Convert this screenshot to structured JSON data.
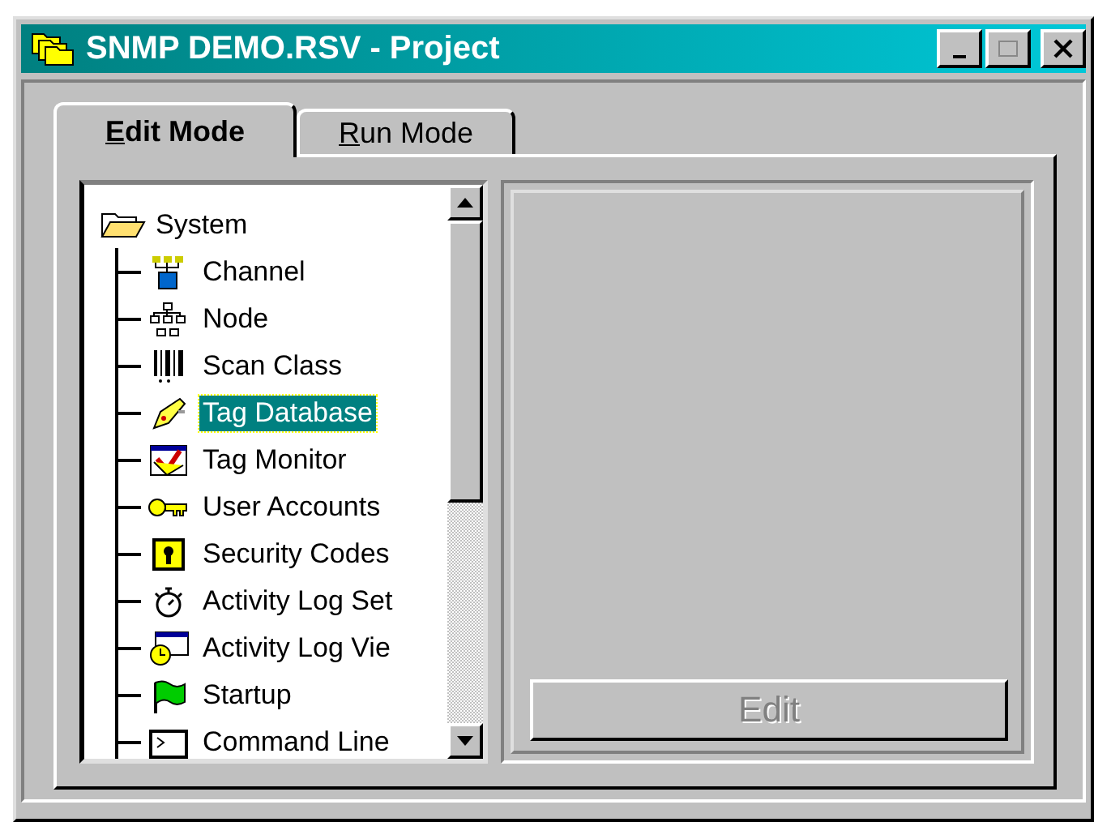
{
  "window": {
    "title": "SNMP DEMO.RSV - Project"
  },
  "tabs": [
    {
      "access_key": "E",
      "label_rest": "dit Mode",
      "selected": true
    },
    {
      "access_key": "R",
      "label_rest": "un Mode",
      "selected": false
    }
  ],
  "tree": {
    "label": "System",
    "expanded": true,
    "children": [
      {
        "label": "Channel",
        "selected": false
      },
      {
        "label": "Node",
        "selected": false
      },
      {
        "label": "Scan Class",
        "selected": false
      },
      {
        "label": "Tag Database",
        "selected": true
      },
      {
        "label": "Tag Monitor",
        "selected": false
      },
      {
        "label": "User Accounts",
        "selected": false
      },
      {
        "label": "Security Codes",
        "selected": false
      },
      {
        "label": "Activity Log Set",
        "selected": false
      },
      {
        "label": "Activity Log Vie",
        "selected": false
      },
      {
        "label": "Startup",
        "selected": false
      },
      {
        "label": "Command Line",
        "selected": false
      }
    ]
  },
  "edit_button": {
    "label": "Edit",
    "disabled": true
  }
}
